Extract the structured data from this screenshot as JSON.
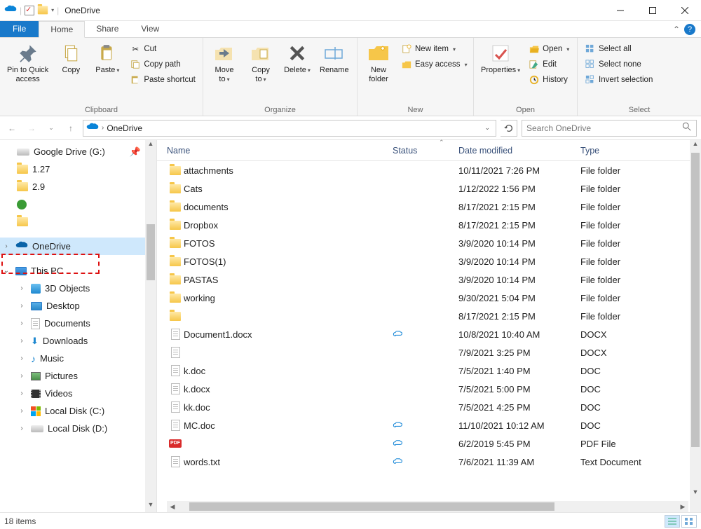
{
  "window": {
    "title": "OneDrive"
  },
  "tabs": {
    "file": "File",
    "home": "Home",
    "share": "Share",
    "view": "View"
  },
  "ribbon": {
    "clipboard": {
      "label": "Clipboard",
      "pin": "Pin to Quick\naccess",
      "copy": "Copy",
      "paste": "Paste",
      "cut": "Cut",
      "copypath": "Copy path",
      "pasteshortcut": "Paste shortcut"
    },
    "organize": {
      "label": "Organize",
      "moveto": "Move\nto",
      "copyto": "Copy\nto",
      "delete": "Delete",
      "rename": "Rename"
    },
    "new": {
      "label": "New",
      "newfolder": "New\nfolder",
      "newitem": "New item",
      "easyaccess": "Easy access"
    },
    "open": {
      "label": "Open",
      "properties": "Properties",
      "open": "Open",
      "edit": "Edit",
      "history": "History"
    },
    "select": {
      "label": "Select",
      "selectall": "Select all",
      "selectnone": "Select none",
      "invert": "Invert selection"
    }
  },
  "address": {
    "path": "OneDrive",
    "search_placeholder": "Search OneDrive"
  },
  "tree": {
    "gdrive": "Google Drive (G:)",
    "f1": "1.27",
    "f2": "2.9",
    "onedrive": "OneDrive",
    "thispc": "This PC",
    "objects3d": "3D Objects",
    "desktop": "Desktop",
    "documents": "Documents",
    "downloads": "Downloads",
    "music": "Music",
    "pictures": "Pictures",
    "videos": "Videos",
    "diskc": "Local Disk (C:)",
    "diskd": "Local Disk (D:)"
  },
  "columns": {
    "name": "Name",
    "status": "Status",
    "date": "Date modified",
    "type": "Type"
  },
  "files": [
    {
      "icon": "folder",
      "name": "attachments",
      "status": "",
      "date": "10/11/2021 7:26 PM",
      "type": "File folder"
    },
    {
      "icon": "folder",
      "name": "Cats",
      "status": "",
      "date": "1/12/2022 1:56 PM",
      "type": "File folder"
    },
    {
      "icon": "folder",
      "name": "documents",
      "status": "",
      "date": "8/17/2021 2:15 PM",
      "type": "File folder"
    },
    {
      "icon": "folder",
      "name": "Dropbox",
      "status": "",
      "date": "8/17/2021 2:15 PM",
      "type": "File folder"
    },
    {
      "icon": "folder",
      "name": "FOTOS",
      "status": "",
      "date": "3/9/2020 10:14 PM",
      "type": "File folder"
    },
    {
      "icon": "folder",
      "name": "FOTOS(1)",
      "status": "",
      "date": "3/9/2020 10:14 PM",
      "type": "File folder"
    },
    {
      "icon": "folder",
      "name": "PASTAS",
      "status": "",
      "date": "3/9/2020 10:14 PM",
      "type": "File folder"
    },
    {
      "icon": "folder",
      "name": "working",
      "status": "",
      "date": "9/30/2021 5:04 PM",
      "type": "File folder"
    },
    {
      "icon": "folder",
      "name": "",
      "status": "",
      "date": "8/17/2021 2:15 PM",
      "type": "File folder"
    },
    {
      "icon": "doc",
      "name": "Document1.docx",
      "status": "cloud",
      "date": "10/8/2021 10:40 AM",
      "type": "DOCX"
    },
    {
      "icon": "doc",
      "name": "",
      "status": "",
      "date": "7/9/2021 3:25 PM",
      "type": "DOCX"
    },
    {
      "icon": "doc",
      "name": "k.doc",
      "status": "",
      "date": "7/5/2021 1:40 PM",
      "type": "DOC"
    },
    {
      "icon": "doc",
      "name": "k.docx",
      "status": "",
      "date": "7/5/2021 5:00 PM",
      "type": "DOC"
    },
    {
      "icon": "doc",
      "name": "kk.doc",
      "status": "",
      "date": "7/5/2021 4:25 PM",
      "type": "DOC"
    },
    {
      "icon": "doc",
      "name": "MC.doc",
      "status": "cloud",
      "date": "11/10/2021 10:12 AM",
      "type": "DOC"
    },
    {
      "icon": "pdf",
      "name": "",
      "status": "cloud",
      "date": "6/2/2019 5:45 PM",
      "type": "PDF File"
    },
    {
      "icon": "doc",
      "name": "words.txt",
      "status": "cloud",
      "date": "7/6/2021 11:39 AM",
      "type": "Text Document"
    }
  ],
  "status": {
    "count": "18 items"
  }
}
